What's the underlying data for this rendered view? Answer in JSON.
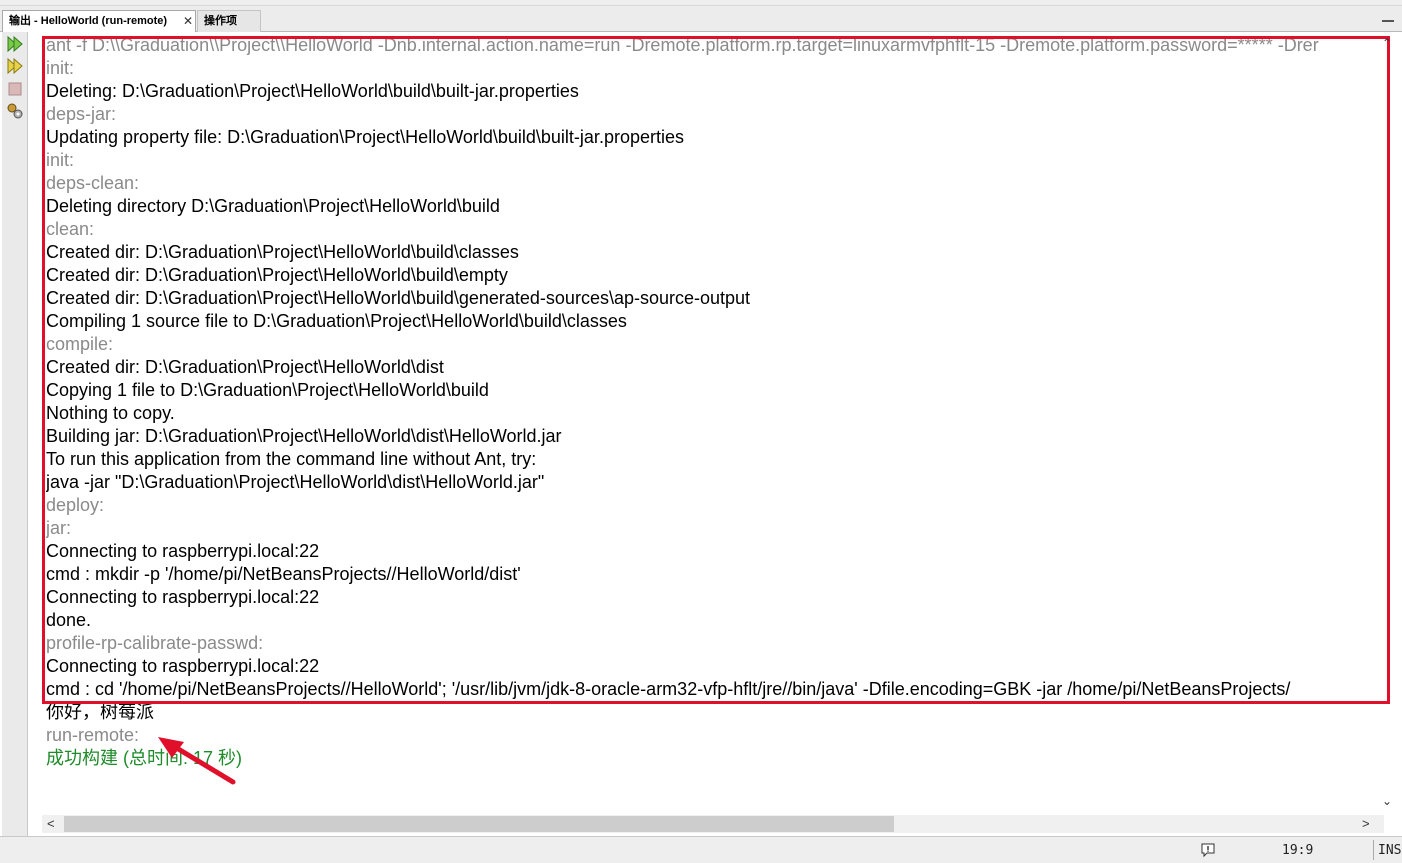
{
  "tabs": {
    "output_label": "输出 - HelloWorld (run-remote)",
    "close_glyph": "✕",
    "actions_label": "操作项"
  },
  "toolbar": {
    "buttons": [
      "rerun-icon",
      "rerun-with-args-icon",
      "stop-icon",
      "ant-settings-icon"
    ]
  },
  "output": {
    "lines": [
      {
        "text": "ant -f D:\\\\Graduation\\\\Project\\\\HelloWorld -Dnb.internal.action.name=run -Dremote.platform.rp.target=linuxarmvfphflt-15 -Dremote.platform.password=***** -Drer",
        "kind": "target"
      },
      {
        "text": "init:",
        "kind": "target"
      },
      {
        "text": "Deleting: D:\\Graduation\\Project\\HelloWorld\\build\\built-jar.properties",
        "kind": "normal"
      },
      {
        "text": "deps-jar:",
        "kind": "target"
      },
      {
        "text": "Updating property file: D:\\Graduation\\Project\\HelloWorld\\build\\built-jar.properties",
        "kind": "normal"
      },
      {
        "text": "init:",
        "kind": "target"
      },
      {
        "text": "deps-clean:",
        "kind": "target"
      },
      {
        "text": "Deleting directory D:\\Graduation\\Project\\HelloWorld\\build",
        "kind": "normal"
      },
      {
        "text": "clean:",
        "kind": "target"
      },
      {
        "text": "Created dir: D:\\Graduation\\Project\\HelloWorld\\build\\classes",
        "kind": "normal"
      },
      {
        "text": "Created dir: D:\\Graduation\\Project\\HelloWorld\\build\\empty",
        "kind": "normal"
      },
      {
        "text": "Created dir: D:\\Graduation\\Project\\HelloWorld\\build\\generated-sources\\ap-source-output",
        "kind": "normal"
      },
      {
        "text": "Compiling 1 source file to D:\\Graduation\\Project\\HelloWorld\\build\\classes",
        "kind": "normal"
      },
      {
        "text": "compile:",
        "kind": "target"
      },
      {
        "text": "Created dir: D:\\Graduation\\Project\\HelloWorld\\dist",
        "kind": "normal"
      },
      {
        "text": "Copying 1 file to D:\\Graduation\\Project\\HelloWorld\\build",
        "kind": "normal"
      },
      {
        "text": "Nothing to copy.",
        "kind": "normal"
      },
      {
        "text": "Building jar: D:\\Graduation\\Project\\HelloWorld\\dist\\HelloWorld.jar",
        "kind": "normal"
      },
      {
        "text": "To run this application from the command line without Ant, try:",
        "kind": "normal"
      },
      {
        "text": "java -jar \"D:\\Graduation\\Project\\HelloWorld\\dist\\HelloWorld.jar\"",
        "kind": "normal"
      },
      {
        "text": "deploy:",
        "kind": "target"
      },
      {
        "text": "jar:",
        "kind": "target"
      },
      {
        "text": "Connecting to raspberrypi.local:22",
        "kind": "normal"
      },
      {
        "text": "cmd : mkdir -p '/home/pi/NetBeansProjects//HelloWorld/dist'",
        "kind": "normal"
      },
      {
        "text": "Connecting to raspberrypi.local:22",
        "kind": "normal"
      },
      {
        "text": "done.",
        "kind": "normal"
      },
      {
        "text": "profile-rp-calibrate-passwd:",
        "kind": "target"
      },
      {
        "text": "Connecting to raspberrypi.local:22",
        "kind": "normal"
      },
      {
        "text": "cmd : cd '/home/pi/NetBeansProjects//HelloWorld'; '/usr/lib/jvm/jdk-8-oracle-arm32-vfp-hflt/jre//bin/java'  -Dfile.encoding=GBK   -jar /home/pi/NetBeansProjects/",
        "kind": "normal"
      },
      {
        "text": "你好，树莓派",
        "kind": "normal"
      },
      {
        "text": "run-remote:",
        "kind": "target"
      },
      {
        "text": "成功构建 (总时间: 17 秒)",
        "kind": "success"
      }
    ]
  },
  "scrollbars": {
    "up": "⌃",
    "down": "⌄",
    "left": "<",
    "right": ">"
  },
  "status": {
    "cursor_position": "19:9",
    "insert_mode": "INS"
  },
  "colors": {
    "highlight_box": "#e0102a",
    "annotation_arrow": "#e0102a",
    "target_text": "#8a8a8a",
    "success_text": "#1f8b2a"
  }
}
